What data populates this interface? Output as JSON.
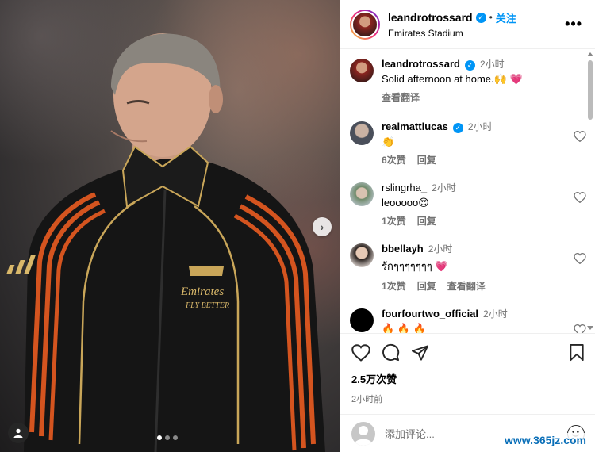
{
  "post": {
    "username": "leandrotrossard",
    "follow_label": "关注",
    "separator": "•",
    "location": "Emirates Stadium",
    "more_label": "•••",
    "carousel_next": "›"
  },
  "caption": {
    "username": "leandrotrossard",
    "time": "2小时",
    "text": "Solid afternoon at home.🙌 💗",
    "translate": "查看翻译"
  },
  "comments": [
    {
      "username": "realmattlucas",
      "verified": true,
      "time": "2小时",
      "text": "👏",
      "likes": "6次赞",
      "reply": "回复",
      "translate": ""
    },
    {
      "username": "rslingrha_",
      "verified": false,
      "time": "2小时",
      "text": "leooooo😍",
      "likes": "1次赞",
      "reply": "回复",
      "translate": ""
    },
    {
      "username": "bbellayh",
      "verified": false,
      "time": "2小时",
      "text": "รักๆๆๆๆๆๆๆ 💗",
      "likes": "1次赞",
      "reply": "回复",
      "translate": "查看翻译"
    },
    {
      "username": "fourfourtwo_official",
      "verified": false,
      "time": "2小时",
      "text": "🔥 🔥 🔥",
      "likes": "",
      "reply": "",
      "translate": ""
    }
  ],
  "stats": {
    "likes": "2.5万次赞",
    "posted": "2小时前"
  },
  "composer": {
    "placeholder": "添加评论..."
  },
  "media": {
    "jacket_text_line1": "Emirates",
    "jacket_text_line2": "FLY BETTER"
  },
  "watermark": "www.365jz.com",
  "icons": [
    "like-icon",
    "comment-icon",
    "share-icon",
    "save-icon",
    "emoji-icon",
    "tag-user-icon",
    "verified-icon"
  ],
  "colors": {
    "accent": "#0095f6",
    "heart": "#ed4956",
    "secondary_text": "#737373"
  }
}
